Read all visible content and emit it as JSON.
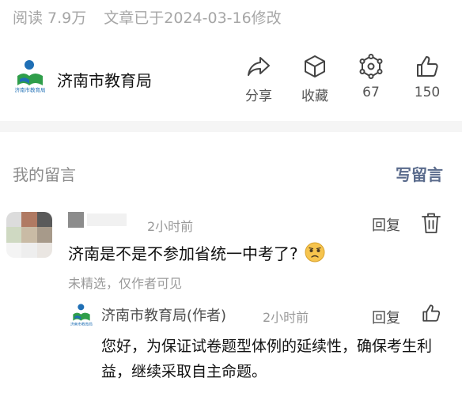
{
  "article_meta": {
    "reads": "阅读 7.9万",
    "modified": "文章已于2024-03-16修改"
  },
  "author": {
    "name": "济南市教育局",
    "logo_text": "济南市教育局"
  },
  "actions": [
    {
      "label": "分享",
      "icon": "share-icon"
    },
    {
      "label": "收藏",
      "icon": "cube-icon"
    },
    {
      "label": "67",
      "icon": "network-icon"
    },
    {
      "label": "150",
      "icon": "thumbs-up-icon"
    }
  ],
  "comments_section": {
    "title": "我的留言",
    "write_label": "写留言"
  },
  "comment": {
    "time": "2小时前",
    "reply_label": "回复",
    "text": "济南是不是不参加省统一中考了?",
    "note": "未精选，仅作者可见",
    "avatar_colors": [
      "#dcdcdc",
      "#b07a63",
      "#5a5a5a",
      "#cfd9c2",
      "#c9bba5",
      "#a79a8a",
      "#f4f4f4",
      "#eeeeee",
      "#eae6e2"
    ]
  },
  "reply": {
    "author": "济南市教育局(作者)",
    "time": "2小时前",
    "reply_label": "回复",
    "text": "您好，为保证试卷题型体例的延续性，确保考生利益，继续采取自主命题。"
  }
}
